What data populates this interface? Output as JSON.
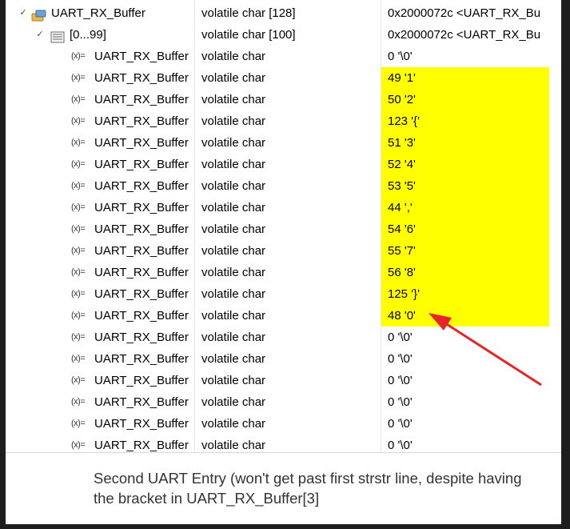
{
  "parent": {
    "name": "UART_RX_Buffer",
    "type": "volatile char [128]",
    "value": "0x2000072c <UART_RX_Bu",
    "icon": "variable-struct-icon"
  },
  "range": {
    "name": "[0...99]",
    "type": "volatile char [100]",
    "value": "0x2000072c <UART_RX_Bu",
    "icon": "array-range-icon"
  },
  "element_icon_label": "(x)=",
  "rows": [
    {
      "name": "UART_RX_Buffer",
      "type": "volatile char",
      "value": "0 '\\0'",
      "highlight": false
    },
    {
      "name": "UART_RX_Buffer",
      "type": "volatile char",
      "value": "49 '1'",
      "highlight": true
    },
    {
      "name": "UART_RX_Buffer",
      "type": "volatile char",
      "value": "50 '2'",
      "highlight": true
    },
    {
      "name": "UART_RX_Buffer",
      "type": "volatile char",
      "value": "123 '{'",
      "highlight": true
    },
    {
      "name": "UART_RX_Buffer",
      "type": "volatile char",
      "value": "51 '3'",
      "highlight": true
    },
    {
      "name": "UART_RX_Buffer",
      "type": "volatile char",
      "value": "52 '4'",
      "highlight": true
    },
    {
      "name": "UART_RX_Buffer",
      "type": "volatile char",
      "value": "53 '5'",
      "highlight": true
    },
    {
      "name": "UART_RX_Buffer",
      "type": "volatile char",
      "value": "44 ','",
      "highlight": true
    },
    {
      "name": "UART_RX_Buffer",
      "type": "volatile char",
      "value": "54 '6'",
      "highlight": true
    },
    {
      "name": "UART_RX_Buffer",
      "type": "volatile char",
      "value": "55 '7'",
      "highlight": true
    },
    {
      "name": "UART_RX_Buffer",
      "type": "volatile char",
      "value": "56 '8'",
      "highlight": true
    },
    {
      "name": "UART_RX_Buffer",
      "type": "volatile char",
      "value": "125 '}'",
      "highlight": true
    },
    {
      "name": "UART_RX_Buffer",
      "type": "volatile char",
      "value": "48 '0'",
      "highlight": true
    },
    {
      "name": "UART_RX_Buffer",
      "type": "volatile char",
      "value": "0 '\\0'",
      "highlight": false
    },
    {
      "name": "UART_RX_Buffer",
      "type": "volatile char",
      "value": "0 '\\0'",
      "highlight": false
    },
    {
      "name": "UART_RX_Buffer",
      "type": "volatile char",
      "value": "0 '\\0'",
      "highlight": false
    },
    {
      "name": "UART_RX_Buffer",
      "type": "volatile char",
      "value": "0 '\\0'",
      "highlight": false
    },
    {
      "name": "UART_RX_Buffer",
      "type": "volatile char",
      "value": "0 '\\0'",
      "highlight": false
    },
    {
      "name": "UART_RX_Buffer",
      "type": "volatile char",
      "value": "0 '\\0'",
      "highlight": false
    }
  ],
  "caption": "Second UART Entry (won't get past first strstr line, despite having the bracket in UART_RX_Buffer[3]",
  "colors": {
    "highlight": "#ffff00",
    "arrow": "#e8232a",
    "background": "#1e1e1e"
  }
}
